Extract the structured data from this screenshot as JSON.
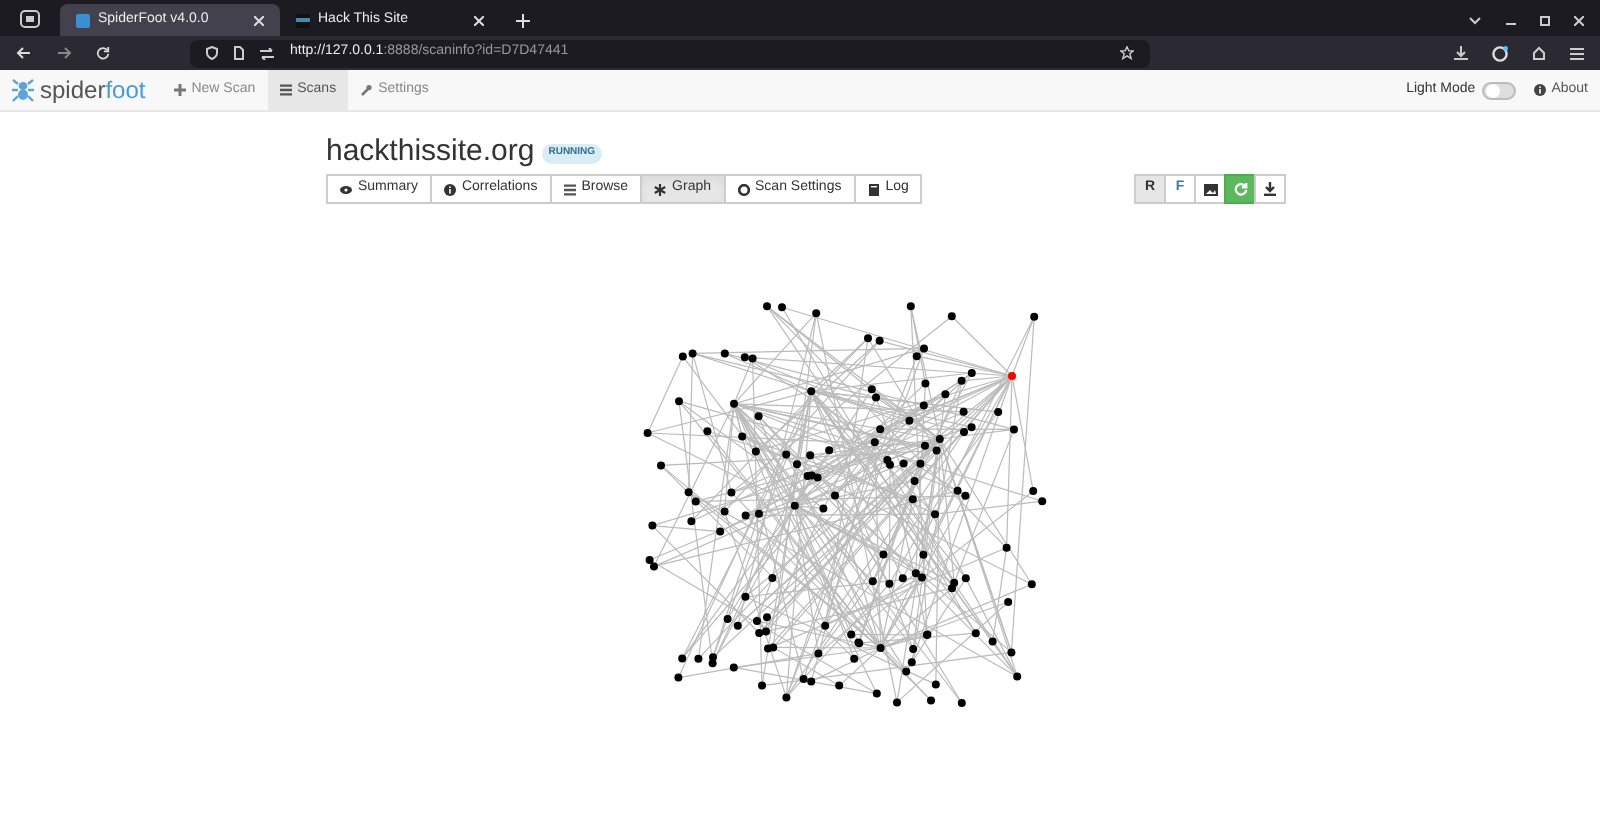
{
  "browser": {
    "tabs": [
      {
        "title": "SpiderFoot v4.0.0",
        "selected": true
      },
      {
        "title": "Hack This Site",
        "selected": false
      }
    ],
    "url_host": "http://127.0.0.1",
    "url_rest": ":8888/scaninfo?id=D7D47441"
  },
  "navbar": {
    "brand_a": "spider",
    "brand_b": "foot",
    "items": [
      {
        "label": "New Scan",
        "selected": false
      },
      {
        "label": "Scans",
        "selected": true
      },
      {
        "label": "Settings",
        "selected": false
      }
    ],
    "light_mode": {
      "label": "Light Mode",
      "on": false
    },
    "about": "About"
  },
  "scan": {
    "title": "hackthissite.org",
    "status": "RUNNING"
  },
  "view_tabs": [
    {
      "label": "Summary",
      "selected": false
    },
    {
      "label": "Correlations",
      "selected": false
    },
    {
      "label": "Browse",
      "selected": false
    },
    {
      "label": "Graph",
      "selected": true
    },
    {
      "label": "Scan Settings",
      "selected": false
    },
    {
      "label": "Log",
      "selected": false
    }
  ],
  "graph_tools": [
    {
      "kind": "text",
      "label": "R",
      "selected": true
    },
    {
      "kind": "text",
      "label": "F",
      "selected": false
    },
    {
      "kind": "image",
      "selected": false
    },
    {
      "kind": "refresh",
      "selected": false
    },
    {
      "kind": "download",
      "selected": false
    }
  ]
}
